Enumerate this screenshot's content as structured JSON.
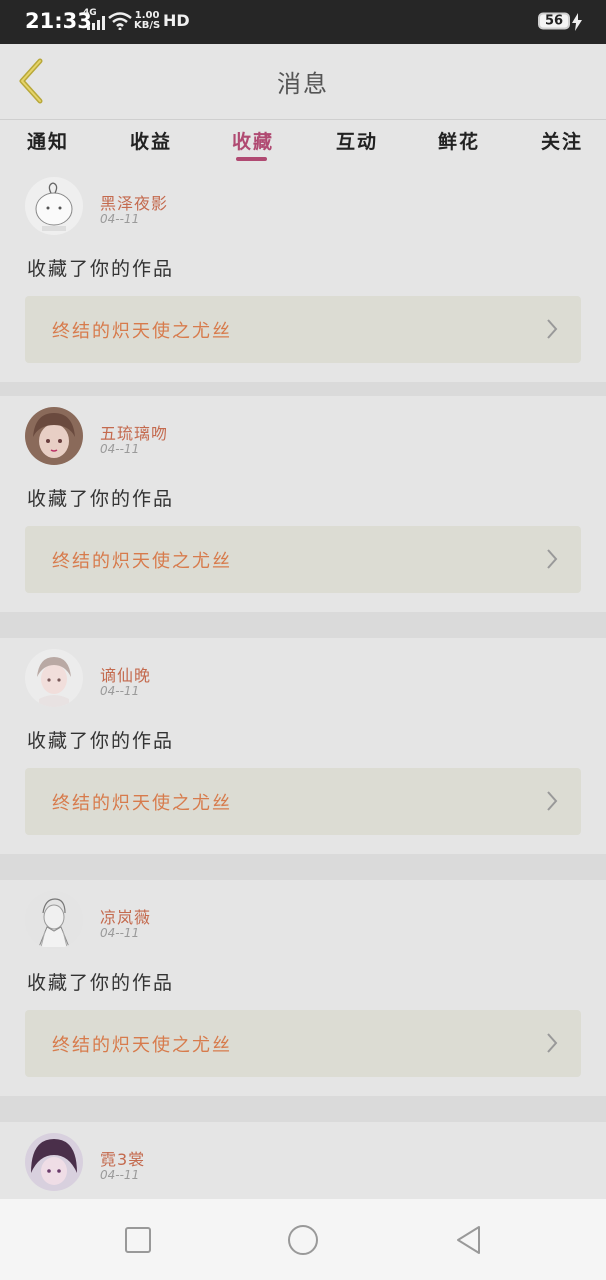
{
  "status_bar": {
    "time": "21:33",
    "network": "4G",
    "speed_value": "1.00",
    "speed_unit": "KB/S",
    "hd": "HD",
    "battery": "56"
  },
  "header": {
    "title": "消息"
  },
  "tabs": [
    {
      "label": "通知"
    },
    {
      "label": "收益"
    },
    {
      "label": "收藏",
      "active": true
    },
    {
      "label": "互动"
    },
    {
      "label": "鲜花"
    },
    {
      "label": "关注"
    }
  ],
  "messages": [
    {
      "user": "黑泽夜影",
      "date": "04--11",
      "action": "收藏了你的作品",
      "work": "终结的炽天使之尤丝"
    },
    {
      "user": "五琉璃吻",
      "date": "04--11",
      "action": "收藏了你的作品",
      "work": "终结的炽天使之尤丝"
    },
    {
      "user": "谪仙晚",
      "date": "04--11",
      "action": "收藏了你的作品",
      "work": "终结的炽天使之尤丝"
    },
    {
      "user": "凉岚薇",
      "date": "04--11",
      "action": "收藏了你的作品",
      "work": "终结的炽天使之尤丝"
    },
    {
      "user": "霓3裳",
      "date": "04--11"
    }
  ],
  "colors": {
    "accent": "#b04a72",
    "username": "#c46a4e",
    "work_title": "#d77b4c",
    "status_bar": "#262626"
  }
}
